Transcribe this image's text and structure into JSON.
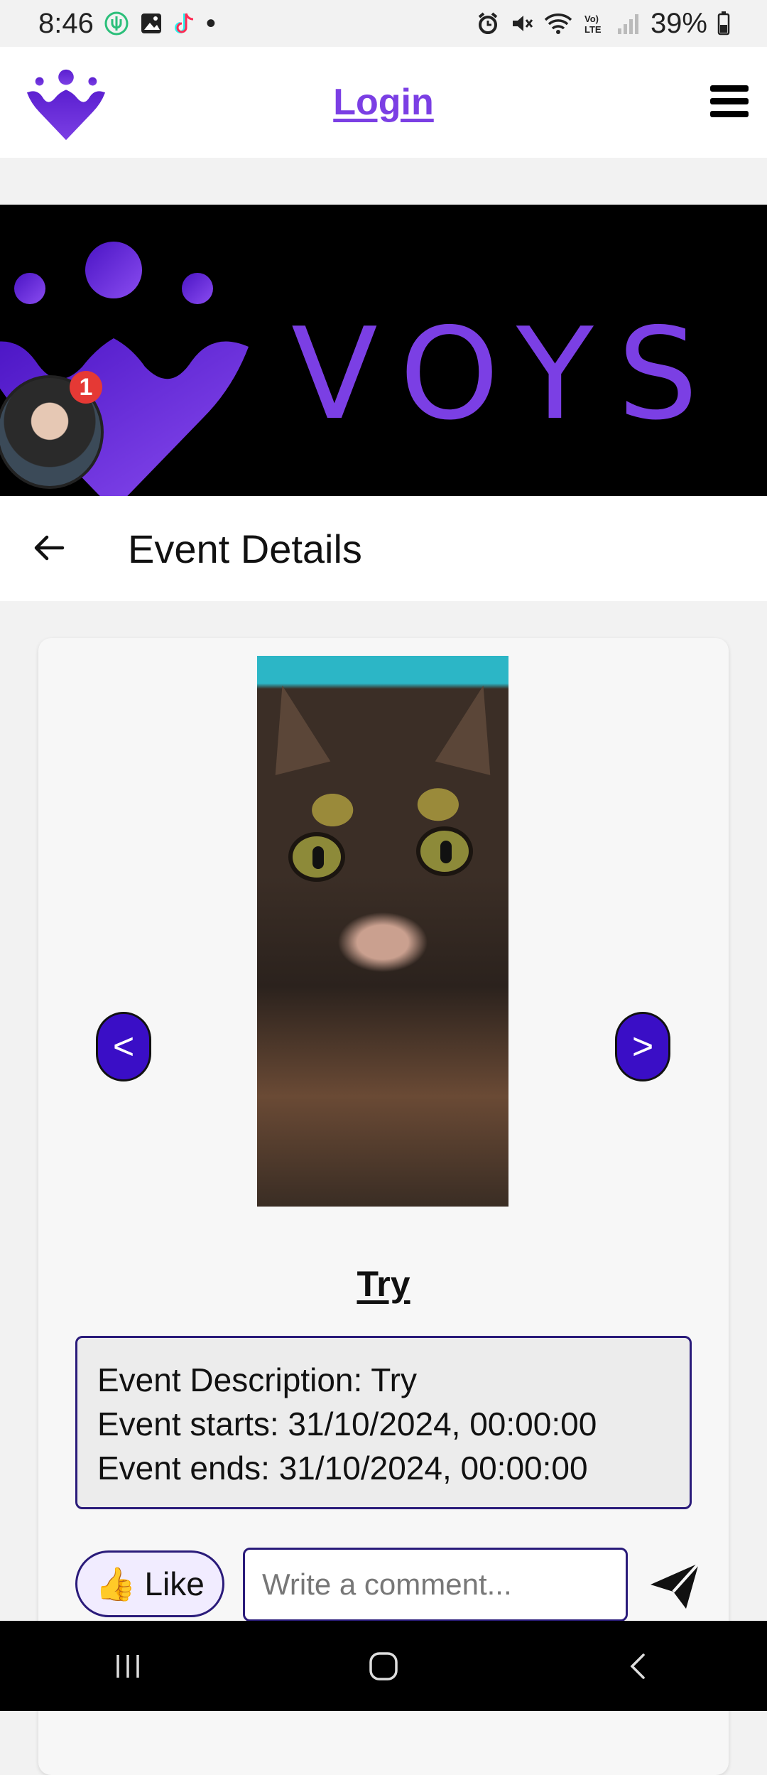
{
  "status_bar": {
    "time": "8:46",
    "battery": "39%",
    "dot": "•"
  },
  "header": {
    "login_label": "Login"
  },
  "banner": {
    "wordmark": "VOYS",
    "notification_count": "1"
  },
  "page": {
    "title": "Event Details"
  },
  "event": {
    "name": "Try",
    "prev_label": "<",
    "next_label": ">",
    "details": {
      "description": "Event Description: Try",
      "starts": "Event starts: 31/10/2024, 00:00:00",
      "ends": "Event ends: 31/10/2024, 00:00:00"
    }
  },
  "actions": {
    "like_emoji": "👍",
    "like_label": "Like",
    "comment_placeholder": "Write a comment..."
  },
  "colors": {
    "brand_purple": "#7b3fe4",
    "button_purple": "#3a0ec6",
    "badge_red": "#e53935"
  }
}
